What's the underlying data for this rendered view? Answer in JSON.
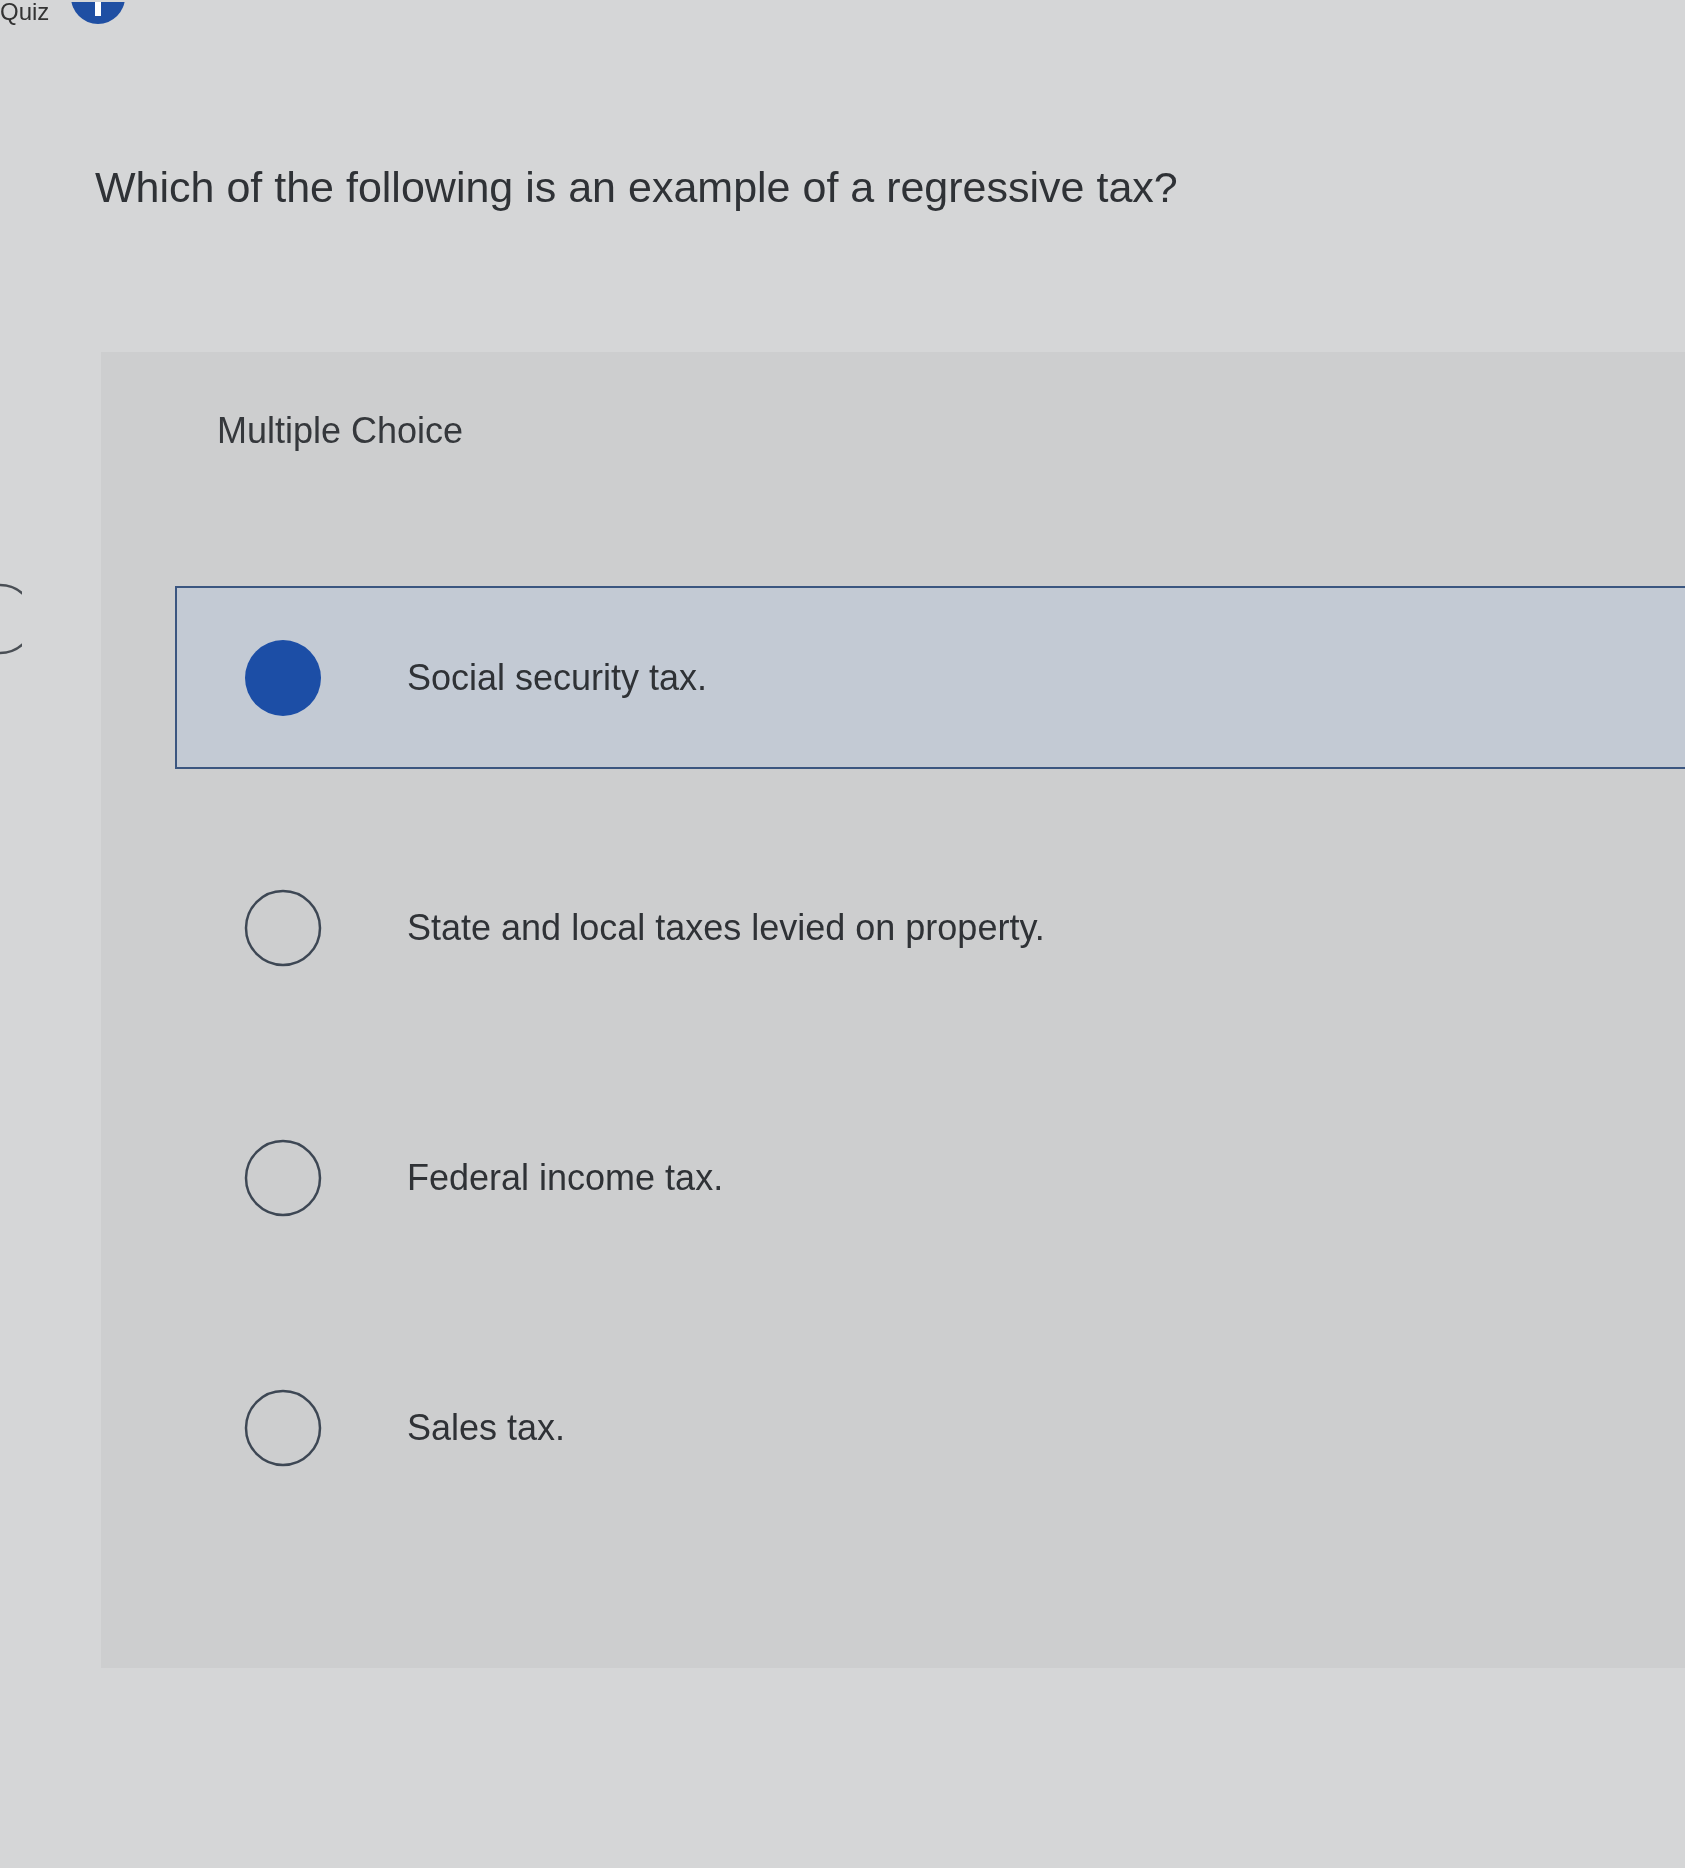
{
  "header": {
    "title": "Quiz"
  },
  "question": "Which of the following is an example of a regressive tax?",
  "answer_panel": {
    "label": "Multiple Choice",
    "options": [
      {
        "text": "Social security tax.",
        "selected": true
      },
      {
        "text": "State and local taxes levied on property.",
        "selected": false
      },
      {
        "text": "Federal income tax.",
        "selected": false
      },
      {
        "text": "Sales tax.",
        "selected": false
      }
    ]
  }
}
